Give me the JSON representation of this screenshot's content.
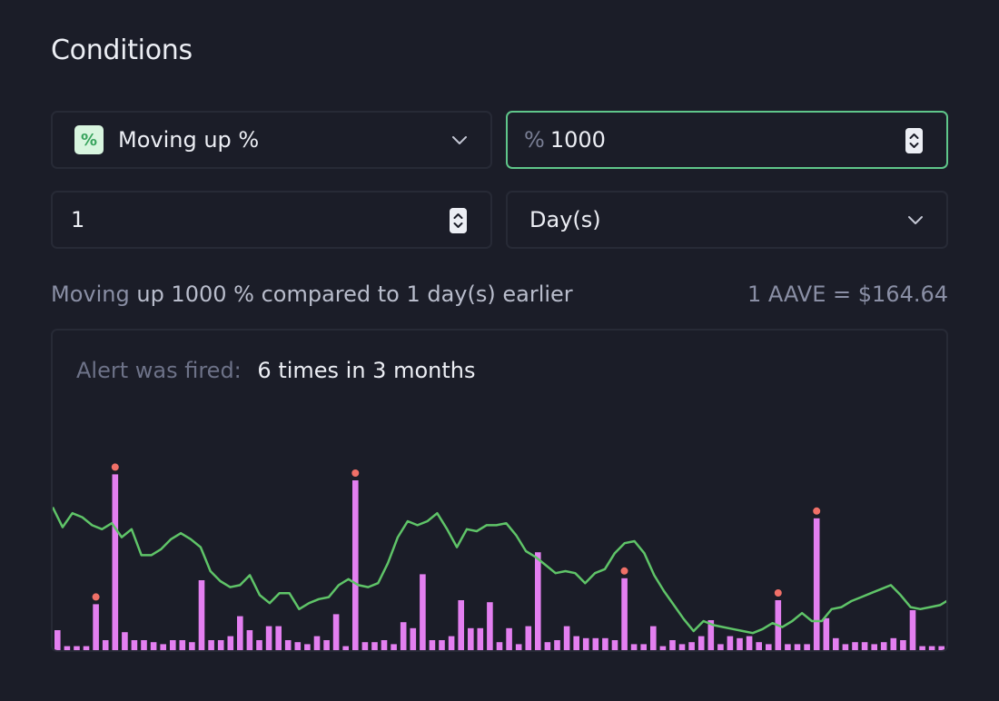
{
  "page": {
    "title": "Conditions"
  },
  "condition": {
    "type_badge": "%",
    "type_label": "Moving up %",
    "percent_prefix": "%",
    "percent_value": "1000",
    "period_value": "1",
    "period_unit": "Day(s)"
  },
  "summary": {
    "lead": "Moving",
    "rest": "up 1000 % compared to 1 day(s) earlier",
    "price": "1 AAVE = $164.64"
  },
  "alert": {
    "label": "Alert was fired:",
    "value": "6 times in 3 months"
  },
  "colors": {
    "bar": "#e37ff0",
    "line": "#5fc468",
    "marker": "#f07068",
    "accent": "#5fc68a"
  },
  "chart_data": {
    "type": "bar",
    "bars": [
      0.1,
      0.02,
      0.02,
      0.02,
      0.23,
      0.05,
      0.88,
      0.09,
      0.05,
      0.05,
      0.04,
      0.03,
      0.05,
      0.05,
      0.04,
      0.35,
      0.05,
      0.05,
      0.07,
      0.17,
      0.1,
      0.05,
      0.12,
      0.12,
      0.05,
      0.04,
      0.03,
      0.07,
      0.05,
      0.18,
      0.02,
      0.85,
      0.04,
      0.04,
      0.05,
      0.03,
      0.14,
      0.11,
      0.38,
      0.05,
      0.05,
      0.07,
      0.25,
      0.11,
      0.11,
      0.24,
      0.04,
      0.11,
      0.03,
      0.12,
      0.49,
      0.04,
      0.05,
      0.12,
      0.07,
      0.06,
      0.06,
      0.06,
      0.05,
      0.36,
      0.03,
      0.03,
      0.12,
      0.02,
      0.05,
      0.03,
      0.04,
      0.07,
      0.15,
      0.03,
      0.07,
      0.06,
      0.07,
      0.04,
      0.03,
      0.25,
      0.03,
      0.03,
      0.03,
      0.66,
      0.16,
      0.06,
      0.03,
      0.04,
      0.04,
      0.03,
      0.04,
      0.06,
      0.05,
      0.2,
      0.02,
      0.02,
      0.02
    ],
    "fired_indices": [
      4,
      6,
      31,
      59,
      75,
      79
    ],
    "line": [
      0.67,
      0.57,
      0.64,
      0.62,
      0.58,
      0.56,
      0.59,
      0.52,
      0.56,
      0.43,
      0.43,
      0.46,
      0.51,
      0.54,
      0.51,
      0.47,
      0.35,
      0.3,
      0.27,
      0.28,
      0.33,
      0.23,
      0.19,
      0.24,
      0.24,
      0.16,
      0.19,
      0.21,
      0.22,
      0.28,
      0.31,
      0.28,
      0.27,
      0.29,
      0.39,
      0.52,
      0.6,
      0.58,
      0.6,
      0.64,
      0.56,
      0.47,
      0.56,
      0.55,
      0.58,
      0.58,
      0.59,
      0.53,
      0.45,
      0.42,
      0.38,
      0.34,
      0.35,
      0.34,
      0.29,
      0.34,
      0.36,
      0.44,
      0.49,
      0.5,
      0.44,
      0.33,
      0.25,
      0.18,
      0.11,
      0.05,
      0.1,
      0.08,
      0.07,
      0.06,
      0.05,
      0.04,
      0.06,
      0.09,
      0.07,
      0.1,
      0.14,
      0.1,
      0.1,
      0.16,
      0.17,
      0.2,
      0.22,
      0.24,
      0.26,
      0.28,
      0.23,
      0.17,
      0.16,
      0.17,
      0.18,
      0.21
    ]
  }
}
